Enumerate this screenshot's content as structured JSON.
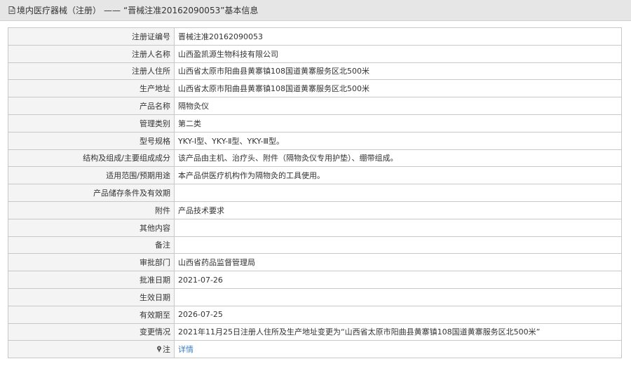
{
  "header": {
    "category": "境内医疗器械（注册）",
    "separator": "——",
    "title": "“晋械注准20162090053”基本信息"
  },
  "rows": [
    {
      "label": "注册证编号",
      "value": "晋械注准20162090053"
    },
    {
      "label": "注册人名称",
      "value": "山西盈凯源生物科技有限公司"
    },
    {
      "label": "注册人住所",
      "value": "山西省太原市阳曲县黄寨镇108国道黄寨服务区北500米"
    },
    {
      "label": "生产地址",
      "value": "山西省太原市阳曲县黄寨镇108国道黄寨服务区北500米"
    },
    {
      "label": "产品名称",
      "value": "隔物灸仪"
    },
    {
      "label": "管理类别",
      "value": "第二类"
    },
    {
      "label": "型号规格",
      "value": "YKY-Ⅰ型、YKY-Ⅱ型、YKY-Ⅲ型。"
    },
    {
      "label": "结构及组成/主要组成成分",
      "value": "该产品由主机、治疗头、附件（隔物灸仪专用护垫）、绷带组成。"
    },
    {
      "label": "适用范围/预期用途",
      "value": "本产品供医疗机构作为隔物灸的工具使用。"
    },
    {
      "label": "产品储存条件及有效期",
      "value": ""
    },
    {
      "label": "附件",
      "value": "产品技术要求"
    },
    {
      "label": "其他内容",
      "value": ""
    },
    {
      "label": "备注",
      "value": ""
    },
    {
      "label": "审批部门",
      "value": "山西省药品监督管理局"
    },
    {
      "label": "批准日期",
      "value": "2021-07-26"
    },
    {
      "label": "生效日期",
      "value": ""
    },
    {
      "label": "有效期至",
      "value": "2026-07-25"
    },
    {
      "label": "变更情况",
      "value": "2021年11月25日注册人住所及生产地址变更为“山西省太原市阳曲县黄寨镇108国道黄寨服务区北500米”"
    }
  ],
  "note_row": {
    "label": "注",
    "icon": "pin-icon",
    "link_text": "详情",
    "link_color": "#3a7fc4"
  }
}
